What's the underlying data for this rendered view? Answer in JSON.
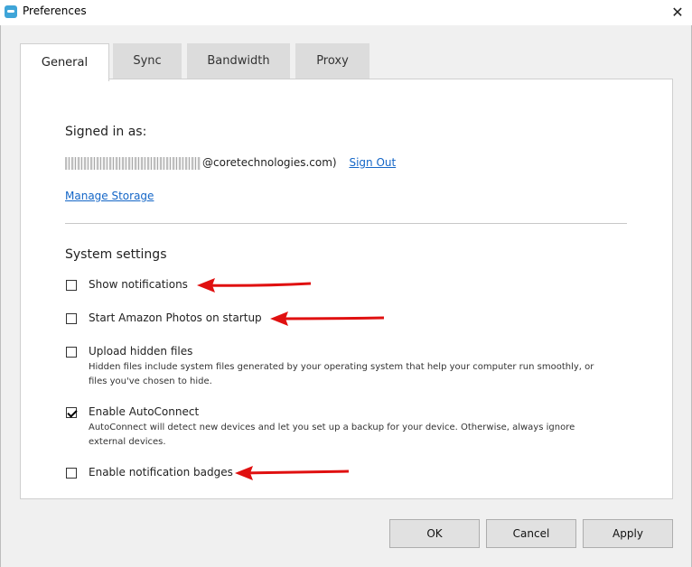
{
  "window": {
    "title": "Preferences",
    "close_glyph": "✕"
  },
  "tabs": [
    {
      "label": "General",
      "active": true
    },
    {
      "label": "Sync",
      "active": false
    },
    {
      "label": "Bandwidth",
      "active": false
    },
    {
      "label": "Proxy",
      "active": false
    }
  ],
  "account": {
    "signed_in_label": "Signed in as:",
    "email_suffix": "@coretechnologies.com)",
    "sign_out_label": "Sign Out",
    "manage_storage_label": "Manage Storage"
  },
  "system_settings": {
    "title": "System settings",
    "options": [
      {
        "label": "Show notifications",
        "checked": false,
        "description": ""
      },
      {
        "label": "Start Amazon Photos on startup",
        "checked": false,
        "description": ""
      },
      {
        "label": "Upload hidden files",
        "checked": false,
        "description": "Hidden files include system files generated by your operating system that help your computer run smoothly, or files you've chosen to hide."
      },
      {
        "label": "Enable AutoConnect",
        "checked": true,
        "description": "AutoConnect will detect new devices and let you set up a backup for your device. Otherwise, always ignore external devices."
      },
      {
        "label": "Enable notification badges",
        "checked": false,
        "description": ""
      }
    ]
  },
  "buttons": {
    "ok": "OK",
    "cancel": "Cancel",
    "apply": "Apply"
  },
  "colors": {
    "link": "#1466c7",
    "annotation_arrow": "#e01010",
    "app_icon": "#3fa5d8"
  },
  "icons": {
    "app": "amazon-photos-icon",
    "close": "close-icon",
    "check": "checkmark-icon",
    "annotation": "red-arrow-icon"
  }
}
